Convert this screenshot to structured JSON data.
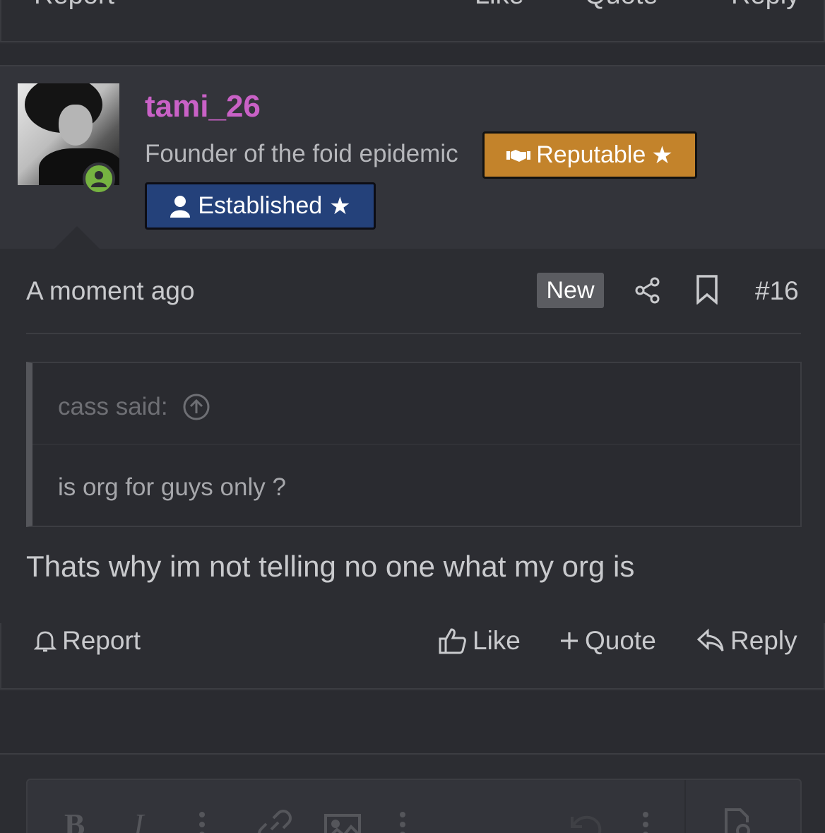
{
  "previous_post": {
    "actions": {
      "report": "Report",
      "like": "Like",
      "quote": "Quote",
      "reply": "Reply"
    }
  },
  "post": {
    "username": "tami_26",
    "user_title": "Founder of the foid epidemic",
    "badges": {
      "reputable": "Reputable",
      "established": "Established"
    },
    "time": "A moment ago",
    "new_label": "New",
    "number": "#16",
    "quote": {
      "author": "cass said:",
      "text": "is org for guys only ?"
    },
    "body": "Thats why im not telling no one what my org is",
    "actions": {
      "report": "Report",
      "like": "Like",
      "quote": "Quote",
      "reply": "Reply"
    }
  },
  "editor": {
    "toolbar": {
      "bold": "B",
      "italic": "I"
    }
  },
  "colors": {
    "username": "#c961c6",
    "reputable": "#c3832b",
    "established": "#24417a",
    "online": "#76b341"
  }
}
